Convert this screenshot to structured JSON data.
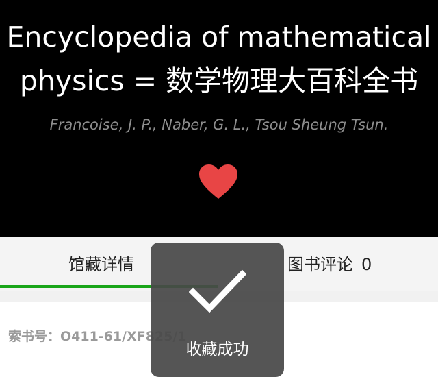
{
  "book": {
    "title": "Encyclopedia of mathematical physics = 数学物理大百科全书",
    "authors": "Francoise, J. P., Naber, G. L., Tsou Sheung Tsun."
  },
  "favorite": {
    "icon": "heart-icon",
    "color": "#e84545"
  },
  "tabs": {
    "details_label": "馆藏详情",
    "comments_label": "图书评论",
    "comments_count": "0",
    "active_color": "#1aa61a"
  },
  "details": {
    "call_number_text": "索书号：O411-61/XF825/1"
  },
  "toast": {
    "icon": "checkmark-icon",
    "message": "收藏成功"
  }
}
